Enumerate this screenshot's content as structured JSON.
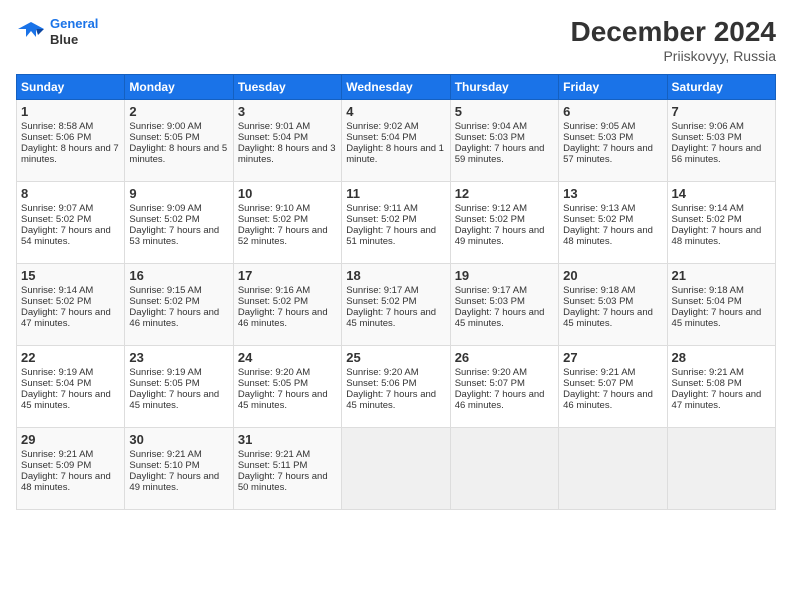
{
  "header": {
    "logo_line1": "General",
    "logo_line2": "Blue",
    "month": "December 2024",
    "location": "Priiskovyy, Russia"
  },
  "days_of_week": [
    "Sunday",
    "Monday",
    "Tuesday",
    "Wednesday",
    "Thursday",
    "Friday",
    "Saturday"
  ],
  "weeks": [
    [
      {
        "day": "1",
        "sunrise": "Sunrise: 8:58 AM",
        "sunset": "Sunset: 5:06 PM",
        "daylight": "Daylight: 8 hours and 7 minutes."
      },
      {
        "day": "2",
        "sunrise": "Sunrise: 9:00 AM",
        "sunset": "Sunset: 5:05 PM",
        "daylight": "Daylight: 8 hours and 5 minutes."
      },
      {
        "day": "3",
        "sunrise": "Sunrise: 9:01 AM",
        "sunset": "Sunset: 5:04 PM",
        "daylight": "Daylight: 8 hours and 3 minutes."
      },
      {
        "day": "4",
        "sunrise": "Sunrise: 9:02 AM",
        "sunset": "Sunset: 5:04 PM",
        "daylight": "Daylight: 8 hours and 1 minute."
      },
      {
        "day": "5",
        "sunrise": "Sunrise: 9:04 AM",
        "sunset": "Sunset: 5:03 PM",
        "daylight": "Daylight: 7 hours and 59 minutes."
      },
      {
        "day": "6",
        "sunrise": "Sunrise: 9:05 AM",
        "sunset": "Sunset: 5:03 PM",
        "daylight": "Daylight: 7 hours and 57 minutes."
      },
      {
        "day": "7",
        "sunrise": "Sunrise: 9:06 AM",
        "sunset": "Sunset: 5:03 PM",
        "daylight": "Daylight: 7 hours and 56 minutes."
      }
    ],
    [
      {
        "day": "8",
        "sunrise": "Sunrise: 9:07 AM",
        "sunset": "Sunset: 5:02 PM",
        "daylight": "Daylight: 7 hours and 54 minutes."
      },
      {
        "day": "9",
        "sunrise": "Sunrise: 9:09 AM",
        "sunset": "Sunset: 5:02 PM",
        "daylight": "Daylight: 7 hours and 53 minutes."
      },
      {
        "day": "10",
        "sunrise": "Sunrise: 9:10 AM",
        "sunset": "Sunset: 5:02 PM",
        "daylight": "Daylight: 7 hours and 52 minutes."
      },
      {
        "day": "11",
        "sunrise": "Sunrise: 9:11 AM",
        "sunset": "Sunset: 5:02 PM",
        "daylight": "Daylight: 7 hours and 51 minutes."
      },
      {
        "day": "12",
        "sunrise": "Sunrise: 9:12 AM",
        "sunset": "Sunset: 5:02 PM",
        "daylight": "Daylight: 7 hours and 49 minutes."
      },
      {
        "day": "13",
        "sunrise": "Sunrise: 9:13 AM",
        "sunset": "Sunset: 5:02 PM",
        "daylight": "Daylight: 7 hours and 48 minutes."
      },
      {
        "day": "14",
        "sunrise": "Sunrise: 9:14 AM",
        "sunset": "Sunset: 5:02 PM",
        "daylight": "Daylight: 7 hours and 48 minutes."
      }
    ],
    [
      {
        "day": "15",
        "sunrise": "Sunrise: 9:14 AM",
        "sunset": "Sunset: 5:02 PM",
        "daylight": "Daylight: 7 hours and 47 minutes."
      },
      {
        "day": "16",
        "sunrise": "Sunrise: 9:15 AM",
        "sunset": "Sunset: 5:02 PM",
        "daylight": "Daylight: 7 hours and 46 minutes."
      },
      {
        "day": "17",
        "sunrise": "Sunrise: 9:16 AM",
        "sunset": "Sunset: 5:02 PM",
        "daylight": "Daylight: 7 hours and 46 minutes."
      },
      {
        "day": "18",
        "sunrise": "Sunrise: 9:17 AM",
        "sunset": "Sunset: 5:02 PM",
        "daylight": "Daylight: 7 hours and 45 minutes."
      },
      {
        "day": "19",
        "sunrise": "Sunrise: 9:17 AM",
        "sunset": "Sunset: 5:03 PM",
        "daylight": "Daylight: 7 hours and 45 minutes."
      },
      {
        "day": "20",
        "sunrise": "Sunrise: 9:18 AM",
        "sunset": "Sunset: 5:03 PM",
        "daylight": "Daylight: 7 hours and 45 minutes."
      },
      {
        "day": "21",
        "sunrise": "Sunrise: 9:18 AM",
        "sunset": "Sunset: 5:04 PM",
        "daylight": "Daylight: 7 hours and 45 minutes."
      }
    ],
    [
      {
        "day": "22",
        "sunrise": "Sunrise: 9:19 AM",
        "sunset": "Sunset: 5:04 PM",
        "daylight": "Daylight: 7 hours and 45 minutes."
      },
      {
        "day": "23",
        "sunrise": "Sunrise: 9:19 AM",
        "sunset": "Sunset: 5:05 PM",
        "daylight": "Daylight: 7 hours and 45 minutes."
      },
      {
        "day": "24",
        "sunrise": "Sunrise: 9:20 AM",
        "sunset": "Sunset: 5:05 PM",
        "daylight": "Daylight: 7 hours and 45 minutes."
      },
      {
        "day": "25",
        "sunrise": "Sunrise: 9:20 AM",
        "sunset": "Sunset: 5:06 PM",
        "daylight": "Daylight: 7 hours and 45 minutes."
      },
      {
        "day": "26",
        "sunrise": "Sunrise: 9:20 AM",
        "sunset": "Sunset: 5:07 PM",
        "daylight": "Daylight: 7 hours and 46 minutes."
      },
      {
        "day": "27",
        "sunrise": "Sunrise: 9:21 AM",
        "sunset": "Sunset: 5:07 PM",
        "daylight": "Daylight: 7 hours and 46 minutes."
      },
      {
        "day": "28",
        "sunrise": "Sunrise: 9:21 AM",
        "sunset": "Sunset: 5:08 PM",
        "daylight": "Daylight: 7 hours and 47 minutes."
      }
    ],
    [
      {
        "day": "29",
        "sunrise": "Sunrise: 9:21 AM",
        "sunset": "Sunset: 5:09 PM",
        "daylight": "Daylight: 7 hours and 48 minutes."
      },
      {
        "day": "30",
        "sunrise": "Sunrise: 9:21 AM",
        "sunset": "Sunset: 5:10 PM",
        "daylight": "Daylight: 7 hours and 49 minutes."
      },
      {
        "day": "31",
        "sunrise": "Sunrise: 9:21 AM",
        "sunset": "Sunset: 5:11 PM",
        "daylight": "Daylight: 7 hours and 50 minutes."
      },
      null,
      null,
      null,
      null
    ]
  ]
}
